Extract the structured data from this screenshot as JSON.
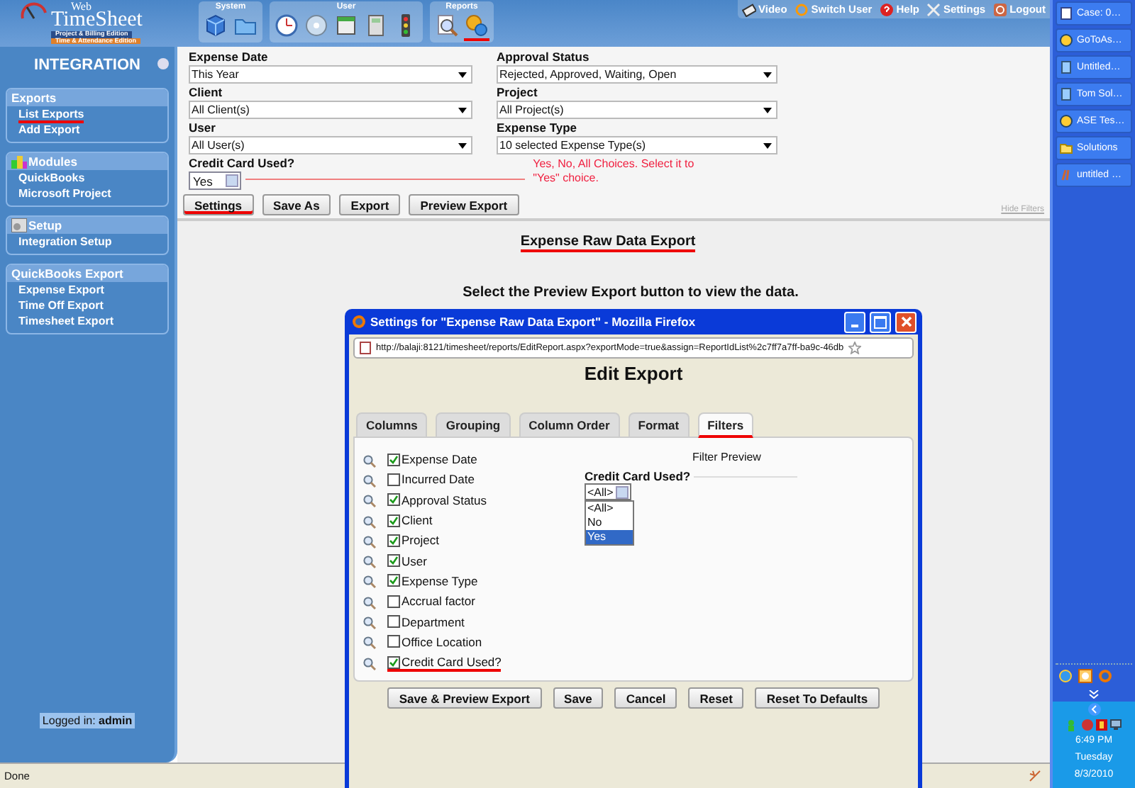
{
  "header": {
    "logo": {
      "prefix": "Web",
      "name": "TimeSheet",
      "edition_1": "Project & Billing Edition",
      "edition_2": "Time & Attendance Edition"
    },
    "toolbar_groups": [
      {
        "label": "System",
        "icons": [
          {
            "kind": "cube",
            "underlined": false
          },
          {
            "kind": "folder",
            "underlined": false
          }
        ]
      },
      {
        "label": "User",
        "icons": [
          {
            "kind": "clock",
            "underlined": false
          },
          {
            "kind": "disc",
            "underlined": false
          },
          {
            "kind": "calendar",
            "underlined": false
          },
          {
            "kind": "calculator",
            "underlined": false
          },
          {
            "kind": "traffic-light",
            "underlined": false
          }
        ]
      },
      {
        "label": "Reports",
        "icons": [
          {
            "kind": "magnifier",
            "underlined": false
          },
          {
            "kind": "gears",
            "underlined": true
          }
        ]
      }
    ],
    "top_links": [
      {
        "label": "Video",
        "kind": "video"
      },
      {
        "label": "Switch User",
        "kind": "switch"
      },
      {
        "label": "Help",
        "kind": "help"
      },
      {
        "label": "Settings",
        "kind": "tools"
      },
      {
        "label": "Logout",
        "kind": "logout"
      }
    ]
  },
  "sidebar": {
    "title": "INTEGRATION",
    "sections": [
      {
        "title": "Exports",
        "kind": "plain",
        "items": [
          {
            "label": "List Exports",
            "underlined": true
          },
          {
            "label": "Add Export",
            "underlined": false
          }
        ]
      },
      {
        "title": "Modules",
        "kind": "modules",
        "items": [
          {
            "label": "QuickBooks",
            "underlined": false
          },
          {
            "label": "Microsoft Project",
            "underlined": false
          }
        ]
      },
      {
        "title": "Setup",
        "kind": "setup",
        "items": [
          {
            "label": "Integration Setup",
            "underlined": false
          }
        ]
      },
      {
        "title": "QuickBooks Export",
        "kind": "plain",
        "items": [
          {
            "label": "Expense Export",
            "underlined": false
          },
          {
            "label": "Time Off Export",
            "underlined": false
          },
          {
            "label": "Timesheet Export",
            "underlined": false
          }
        ]
      }
    ],
    "footer": {
      "label": "Logged in:",
      "user": "admin"
    }
  },
  "filters": [
    {
      "label": "Expense Date",
      "value": "This Year"
    },
    {
      "label": "Approval Status",
      "value": "Rejected, Approved, Waiting, Open"
    },
    {
      "label": "Client",
      "value": "All Client(s)"
    },
    {
      "label": "Project",
      "value": "All Project(s)"
    },
    {
      "label": "User",
      "value": "All User(s)"
    },
    {
      "label": "Expense Type",
      "value": "10 selected Expense Type(s)"
    }
  ],
  "credit_card": {
    "label": "Credit Card Used?",
    "value": "Yes",
    "callout": "Yes, No, All Choices. Select it to \"Yes\" choice."
  },
  "buttons": [
    {
      "label": "Settings",
      "underlined": true
    },
    {
      "label": "Save As",
      "underlined": false
    },
    {
      "label": "Export",
      "underlined": false
    },
    {
      "label": "Preview Export",
      "underlined": false
    }
  ],
  "hide_filters": "Hide Filters",
  "report_title": {
    "text": "Expense Raw Data Export",
    "underlined": true
  },
  "message": "Select the Preview Export button to view the data.",
  "dialog": {
    "title": "Settings for \"Expense Raw Data Export\" - Mozilla Firefox",
    "url": "http://balaji:8121/timesheet/reports/EditReport.aspx?exportMode=true&assign=ReportIdList%2c7ff7a7ff-ba9c-46db",
    "heading": "Edit Export",
    "tabs": [
      {
        "label": "Columns",
        "selected": false,
        "underlined": false
      },
      {
        "label": "Grouping",
        "selected": false,
        "underlined": false
      },
      {
        "label": "Column Order",
        "selected": false,
        "underlined": false
      },
      {
        "label": "Format",
        "selected": false,
        "underlined": false
      },
      {
        "label": "Filters",
        "selected": true,
        "underlined": true
      }
    ],
    "fields": [
      {
        "label": "Expense Date",
        "checked": true,
        "underlined": false
      },
      {
        "label": "Incurred Date",
        "checked": false,
        "underlined": false
      },
      {
        "label": "Approval Status",
        "checked": true,
        "underlined": false
      },
      {
        "label": "Client",
        "checked": true,
        "underlined": false
      },
      {
        "label": "Project",
        "checked": true,
        "underlined": false
      },
      {
        "label": "User",
        "checked": true,
        "underlined": false
      },
      {
        "label": "Expense Type",
        "checked": true,
        "underlined": false
      },
      {
        "label": "Accrual factor",
        "checked": false,
        "underlined": false
      },
      {
        "label": "Department",
        "checked": false,
        "underlined": false
      },
      {
        "label": "Office Location",
        "checked": false,
        "underlined": false
      },
      {
        "label": "Credit Card Used?",
        "checked": true,
        "underlined": true
      }
    ],
    "preview": {
      "title": "Filter Preview",
      "label": "Credit Card Used?",
      "value": "<All>",
      "options": [
        {
          "label": "<All>",
          "highlighted": false
        },
        {
          "label": "No",
          "highlighted": false
        },
        {
          "label": "Yes",
          "highlighted": true
        }
      ]
    },
    "buttons": [
      "Save & Preview Export",
      "Save",
      "Cancel",
      "Reset",
      "Reset To Defaults"
    ]
  },
  "status_bar": {
    "text": "Done"
  },
  "taskbar": {
    "windows": [
      {
        "label": "Case: 0…",
        "kind": "page"
      },
      {
        "label": "GoToAs…",
        "kind": "ring"
      },
      {
        "label": "Untitled…",
        "kind": "note"
      },
      {
        "label": "Tom Sol…",
        "kind": "note"
      },
      {
        "label": "ASE Tes…",
        "kind": "ring"
      },
      {
        "label": "Solutions",
        "kind": "folder"
      },
      {
        "label": "untitled …",
        "kind": "paint"
      }
    ],
    "clock": {
      "time": "6:49 PM",
      "day": "Tuesday",
      "date": "8/3/2010"
    }
  }
}
